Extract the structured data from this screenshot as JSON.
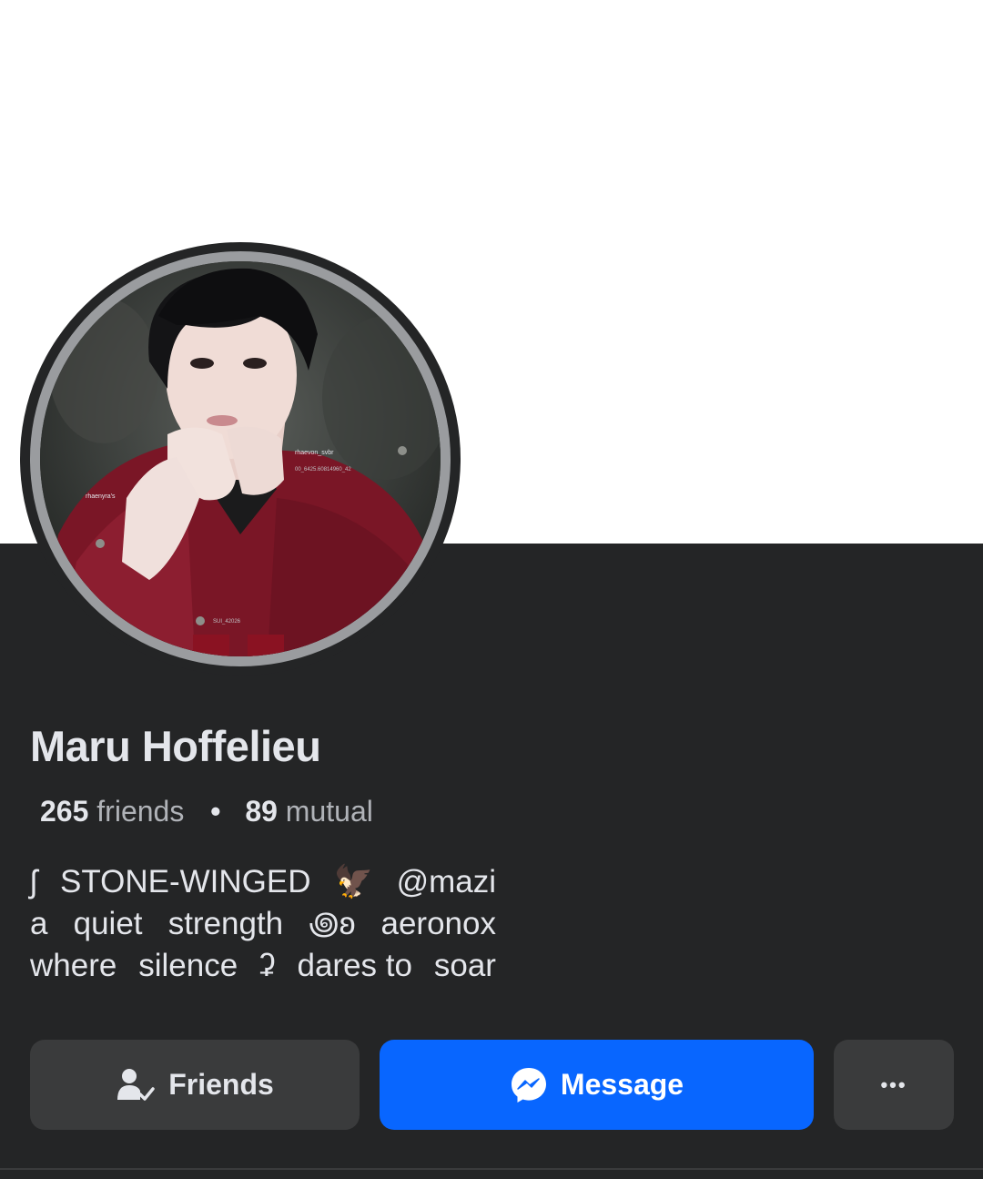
{
  "profile": {
    "name": "Maru Hoffelieu",
    "friends_count": "265",
    "friends_label": "friends",
    "separator": "•",
    "mutual_count": "89",
    "mutual_label": "mutual",
    "avatar_alt": "profile picture"
  },
  "bio": {
    "line1": [
      "ʃ",
      "STONE-WINGED",
      "🦅",
      "@mazi"
    ],
    "line2": [
      "a",
      "quiet",
      "strength",
      "꩜ʚ",
      "aeronox"
    ],
    "line3": [
      "where",
      "silence",
      "ʡ",
      "dares to",
      "soar"
    ]
  },
  "actions": {
    "friends_label": "Friends",
    "friends_icon": "friend-check-icon",
    "message_label": "Message",
    "message_icon": "messenger-icon",
    "more_label": "•••",
    "more_icon": "more-options-icon"
  },
  "colors": {
    "background": "#242526",
    "cover": "#ffffff",
    "primary_button": "#0866ff",
    "secondary_button": "#3a3b3c",
    "text_primary": "#e4e6eb",
    "text_secondary": "#b0b3b8"
  }
}
